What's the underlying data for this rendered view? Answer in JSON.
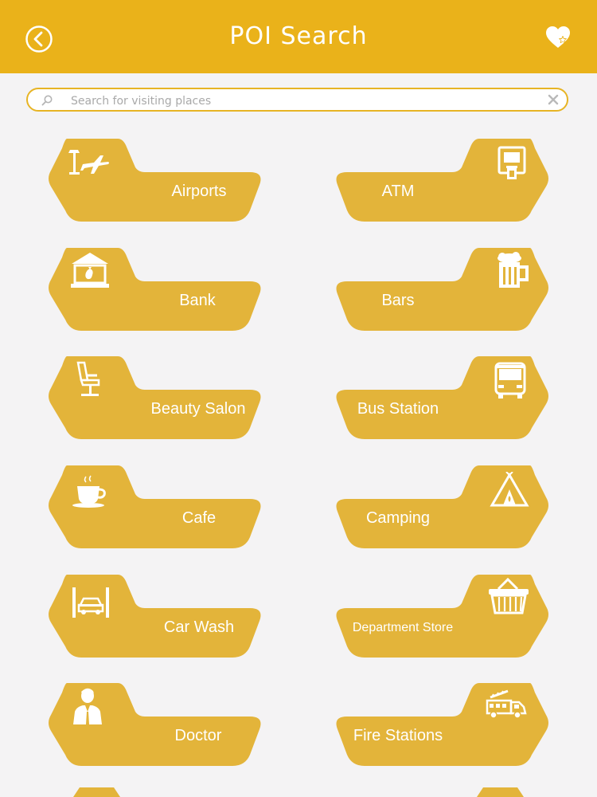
{
  "header": {
    "title": "POI Search",
    "back_icon": "back-arrow-icon",
    "favorite_icon": "heart-star-icon",
    "color": "#eab21a"
  },
  "search": {
    "placeholder": "Search for visiting places",
    "value": ""
  },
  "categories": [
    {
      "label": "Airports",
      "icon": "airport-icon"
    },
    {
      "label": "ATM",
      "icon": "atm-icon"
    },
    {
      "label": "Bank",
      "icon": "bank-icon"
    },
    {
      "label": "Bars",
      "icon": "beer-mug-icon"
    },
    {
      "label": "Beauty Salon",
      "icon": "salon-chair-icon"
    },
    {
      "label": "Bus Station",
      "icon": "bus-icon"
    },
    {
      "label": "Cafe",
      "icon": "coffee-cup-icon"
    },
    {
      "label": "Camping",
      "icon": "tent-icon"
    },
    {
      "label": "Car Wash",
      "icon": "car-wash-icon"
    },
    {
      "label": "Department Store",
      "icon": "basket-icon"
    },
    {
      "label": "Doctor",
      "icon": "doctor-icon"
    },
    {
      "label": "Fire Stations",
      "icon": "fire-truck-icon"
    }
  ],
  "tile_color": "#e3b43a"
}
